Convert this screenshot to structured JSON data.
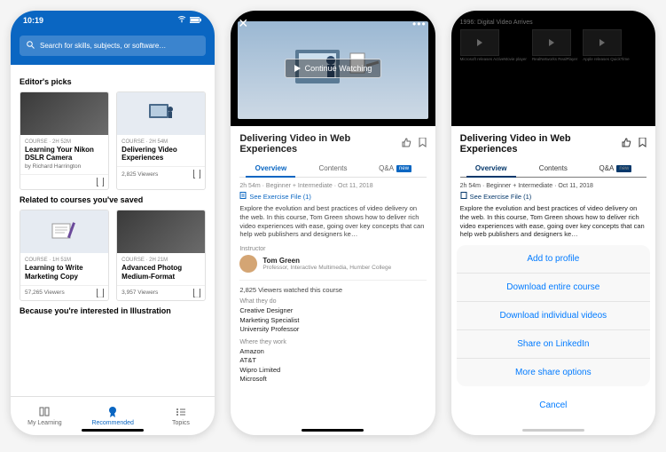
{
  "phone1": {
    "time": "10:19",
    "search_placeholder": "Search for skills, subjects, or software…",
    "editors_picks": "Editor's picks",
    "card1": {
      "meta": "COURSE · 2h 52m",
      "title": "Learning Your Nikon DSLR Camera",
      "author": "by Richard Harrington"
    },
    "card2": {
      "meta": "COURSE · 2h 54m",
      "title": "Delivering Video Experiences",
      "viewers": "2,825 Viewers"
    },
    "related": "Related to courses you've saved",
    "card3": {
      "meta": "COURSE · 1h 51m",
      "title": "Learning to Write Marketing Copy",
      "viewers": "57,265 Viewers"
    },
    "card4": {
      "meta": "COURSE · 2h 21m",
      "title": "Advanced Photog Medium-Format",
      "viewers": "3,957 Viewers"
    },
    "interested": "Because you're interested in Illustration",
    "tabs": {
      "mylearning": "My Learning",
      "recommended": "Recommended",
      "topics": "Topics"
    }
  },
  "phone2": {
    "continue": "Continue Watching",
    "title": "Delivering Video in Web Experiences",
    "tabs": {
      "overview": "Overview",
      "contents": "Contents",
      "qa": "Q&A",
      "new": "new"
    },
    "meta": "2h 54m · Beginner + Intermediate · Oct 11, 2018",
    "exercise": "See Exercise File (1)",
    "desc": "Explore the evolution and best practices of video delivery on the web. In this course, Tom Green shows how to deliver rich video experiences with ease, going over key concepts that can help web publishers and designers ke…",
    "instructor_label": "Instructor",
    "instructor_name": "Tom Green",
    "instructor_title": "Professor, Interactive Multimedia, Humber College",
    "viewers": "2,825 Viewers watched this course",
    "what_they_do": "What they do",
    "roles": [
      "Creative Designer",
      "Marketing Specialist",
      "University Professor"
    ],
    "where_they_work": "Where they work",
    "companies": [
      "Amazon",
      "AT&T",
      "Wipro Limited",
      "Microsoft"
    ]
  },
  "phone3": {
    "timeline_title": "1996: Digital Video Arrives",
    "thumbs": [
      "Microsoft releases ActiveMovie player",
      "RealNetworks RealPlayer",
      "Apple releases QuickTime"
    ],
    "title": "Delivering Video in Web Experiences",
    "sheet": {
      "add": "Add to profile",
      "download_course": "Download entire course",
      "download_videos": "Download individual videos",
      "share": "Share on LinkedIn",
      "more": "More share options",
      "cancel": "Cancel"
    }
  },
  "common": {
    "tabs": {
      "overview": "Overview",
      "contents": "Contents",
      "qa": "Q&A",
      "new": "new"
    },
    "meta": "2h 54m · Beginner + Intermediate · Oct 11, 2018",
    "exercise": "See Exercise File (1)",
    "desc": "Explore the evolution and best practices of video delivery on the web. In this course, Tom Green shows how to deliver rich video experiences with ease, going over key concepts that can help web publishers and designers ke…"
  }
}
